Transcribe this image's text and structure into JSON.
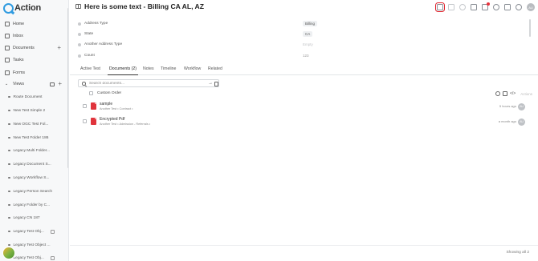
{
  "app": {
    "logo_text": "Action"
  },
  "sidebar": {
    "nav": [
      {
        "label": "Home",
        "icon": "home-icon"
      },
      {
        "label": "Inbox",
        "icon": "inbox-icon"
      },
      {
        "label": "Documents",
        "icon": "documents-icon",
        "has_add": true
      },
      {
        "label": "Tasks",
        "icon": "tasks-icon"
      },
      {
        "label": "Forms",
        "icon": "forms-icon"
      }
    ],
    "views_label": "Views",
    "views": [
      "Route Document",
      "New Test Simple 2",
      "New OGC Test Fol...",
      "New Test Folder 186",
      "Legacy Multi Folder...",
      "Legacy Document S...",
      "Legacy Workflow S...",
      "Legacy Person Search",
      "Legacy Folder by C...",
      "Legacy CN 187",
      "Legacy Test Obj...",
      "Legacy Test Object ...",
      "Legacy Test Obj..."
    ],
    "plus_glyph": "+"
  },
  "header": {
    "title": "Here is some text - Billing CA AL, AZ",
    "icons": [
      "bookmark-icon",
      "star-icon",
      "history-icon",
      "share-icon",
      "notification-icon",
      "clock-icon",
      "comment-icon",
      "settings-icon"
    ],
    "user_initials": "AU"
  },
  "fields": [
    {
      "label": "Address Type",
      "value": "Billing",
      "style": "pill"
    },
    {
      "label": "State",
      "value": "CA",
      "style": "pill"
    },
    {
      "label": "Another Address Type",
      "value": "Empty",
      "style": "placeholder"
    },
    {
      "label": "Count",
      "value": "123",
      "style": "plain"
    }
  ],
  "tabs": [
    {
      "label": "Active Test",
      "active": false
    },
    {
      "label": "Documents (2)",
      "active": true
    },
    {
      "label": "Notes",
      "active": false
    },
    {
      "label": "Timeline",
      "active": false
    },
    {
      "label": "Workflow",
      "active": false
    },
    {
      "label": "Related",
      "active": false
    }
  ],
  "search": {
    "placeholder": "Search documents...",
    "go_glyph": "→"
  },
  "list": {
    "custom_order_label": "Custom Order",
    "code_glyph": "</>",
    "actions_label": "Actions",
    "documents": [
      {
        "title": "sample",
        "meta": "Another Test • Contract •",
        "time": "5 hours ago",
        "avatar": "AU"
      },
      {
        "title": "Encrypted Pdf",
        "meta": "Another Test • Admission - Referrals •",
        "time": "a month ago",
        "avatar": "AU"
      }
    ]
  },
  "footer": {
    "showing": "Showing all 2"
  },
  "colors": {
    "accent": "#2f9be0",
    "pdf": "#e0343c",
    "highlight": "#e0202a",
    "notification": "#e8303a"
  }
}
